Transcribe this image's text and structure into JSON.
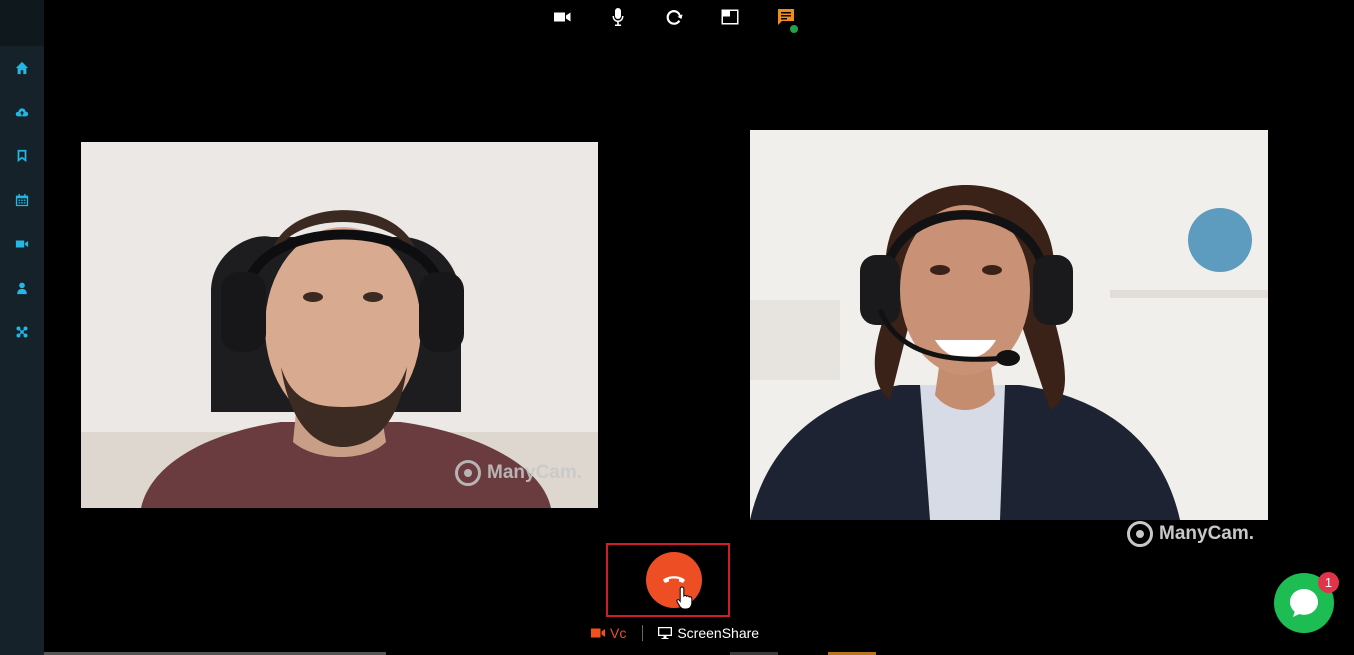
{
  "sidebar": {
    "items": [
      {
        "icon": "home-icon"
      },
      {
        "icon": "cloud-upload-icon"
      },
      {
        "icon": "bookmark-icon"
      },
      {
        "icon": "calendar-icon"
      },
      {
        "icon": "video-camera-icon"
      },
      {
        "icon": "user-icon"
      },
      {
        "icon": "network-icon"
      }
    ],
    "icon_color": "#23b7e5"
  },
  "toolbar": {
    "buttons": [
      {
        "icon": "video-camera-icon"
      },
      {
        "icon": "microphone-icon"
      },
      {
        "icon": "refresh-icon"
      },
      {
        "icon": "layout-icon"
      },
      {
        "icon": "chat-icon"
      }
    ]
  },
  "videos": {
    "left": {
      "watermark": "ManyCam."
    },
    "right": {
      "watermark": "ManyCam."
    }
  },
  "end_call": {
    "icon": "hang-up-icon",
    "color": "#ee4e23"
  },
  "modes": {
    "vc": "Vc",
    "screenshare": "ScreenShare"
  },
  "chat_widget": {
    "badge": "1",
    "color": "#1dbd54"
  }
}
